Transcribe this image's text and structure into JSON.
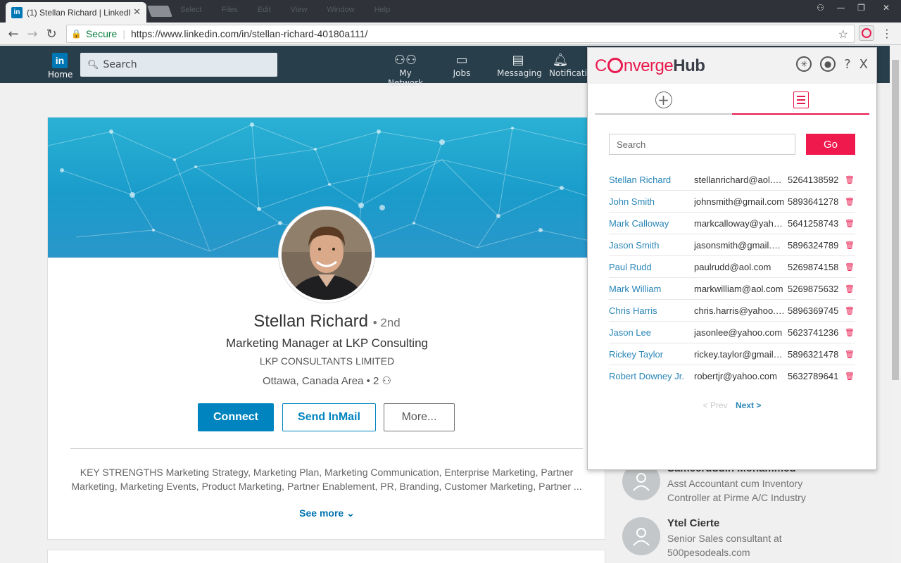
{
  "browser": {
    "tab_title": "(1) Stellan Richard | LinkedIn",
    "tab_favicon": "in",
    "tab_close": "✕",
    "menu": [
      "Select",
      "Files",
      "Edit",
      "View",
      "Window",
      "Help"
    ],
    "secure_label": "Secure",
    "url": "https://www.linkedin.com/in/stellan-richard-40180a111/"
  },
  "linkedin_nav": {
    "logo": "in",
    "home_label": "Home",
    "search_placeholder": "Search",
    "items": [
      {
        "label": "My Network",
        "icon": "network-icon"
      },
      {
        "label": "Jobs",
        "icon": "briefcase-icon"
      },
      {
        "label": "Messaging",
        "icon": "messaging-icon"
      },
      {
        "label": "Notifications",
        "icon": "bell-icon"
      }
    ]
  },
  "profile": {
    "name": "Stellan Richard",
    "degree": "• 2nd",
    "headline": "Marketing Manager at LKP Consulting",
    "company": "LKP CONSULTANTS LIMITED",
    "location": "Ottawa, Canada Area",
    "connections": "• 2",
    "connect_label": "Connect",
    "inmail_label": "Send InMail",
    "more_label": "More...",
    "summary": "KEY STRENGTHS Marketing Strategy, Marketing Plan, Marketing Communication, Enterprise Marketing, Partner Marketing, Marketing Events, Product Marketing, Partner Enablement, PR, Branding, Customer Marketing, Partner ...",
    "see_more": "See more"
  },
  "sidebar_people": [
    {
      "name": "Sameeruddin Mohammed",
      "desc": "Asst Accountant cum Inventory Controller at Pirme A/C Industry"
    },
    {
      "name": "Ytel Cierte",
      "desc": "Senior Sales consultant at 500pesodeals.com"
    }
  ],
  "converge": {
    "logo_c": "C",
    "logo_nverge": "nverge",
    "logo_hub": "Hub",
    "help": "?",
    "close": "X",
    "search_placeholder": "Search",
    "go_label": "Go",
    "contacts": [
      {
        "name": "Stellan Richard",
        "email": "stellanrichard@aol.com",
        "phone": "5264138592"
      },
      {
        "name": "John Smith",
        "email": "johnsmith@gmail.com",
        "phone": "5893641278"
      },
      {
        "name": "Mark Calloway",
        "email": "markcalloway@yahoo.com",
        "phone": "5641258743"
      },
      {
        "name": "Jason Smith",
        "email": "jasonsmith@gmail.com",
        "phone": "5896324789"
      },
      {
        "name": "Paul Rudd",
        "email": "paulrudd@aol.com",
        "phone": "5269874158"
      },
      {
        "name": "Mark William",
        "email": "markwilliam@aol.com",
        "phone": "5269875632"
      },
      {
        "name": "Chris Harris",
        "email": "chris.harris@yahoo.com",
        "phone": "5896369745"
      },
      {
        "name": "Jason Lee",
        "email": "jasonlee@yahoo.com",
        "phone": "5623741236"
      },
      {
        "name": "Rickey Taylor",
        "email": "rickey.taylor@gmail.com",
        "phone": "5896321478"
      },
      {
        "name": "Robert Downey Jr.",
        "email": "robertjr@yahoo.com",
        "phone": "5632789641"
      }
    ],
    "prev_label": "< Prev",
    "next_label": "Next >",
    "accent_color": "#e8194d"
  }
}
